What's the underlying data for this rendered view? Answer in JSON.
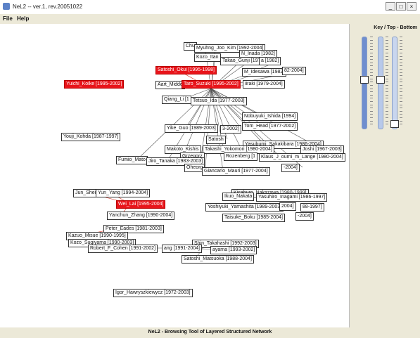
{
  "window": {
    "title": "NeL2 -- ver.1, rev.20051022",
    "min": "_",
    "max": "□",
    "close": "×"
  },
  "menu": {
    "items": [
      "File",
      "Help"
    ]
  },
  "panel": {
    "header": "Key / Top - Bottom",
    "sliders": [
      {
        "name": "slider-1",
        "color": "#6f8ecf",
        "level": 0.46
      },
      {
        "name": "slider-2",
        "color": "#b8c9ea",
        "level": 0.46
      },
      {
        "name": "slider-3",
        "color": "#c9d6ee",
        "level": 0.98
      }
    ]
  },
  "status": "NeL2 - Browsing Tool of Layered Structured Network",
  "graph": {
    "nodes": [
      {
        "label": "Chu",
        "selected": false
      },
      {
        "label": "Myuhng_Joo_Kim [1992-2004]",
        "selected": false
      },
      {
        "label": "N_Inada [1982]",
        "selected": false
      },
      {
        "label": "Kozo_Itan",
        "selected": false
      },
      {
        "label": "Takao_Gunji [1977]",
        "selected": false
      },
      {
        "label": "a [1982]",
        "selected": false
      },
      {
        "label": "Satoshi_Okui [1995-1998]",
        "selected": true
      },
      {
        "label": "M_Idesawa [1982]",
        "selected": false
      },
      {
        "label": "82-2004]",
        "selected": false
      },
      {
        "label": "Yuichi_Koike [1995-2002]",
        "selected": true
      },
      {
        "label": "Aart_Midde",
        "selected": false
      },
      {
        "label": "Taro_Suzuki [1995-2002]",
        "selected": true
      },
      {
        "label": "iiraki [1979-2004]",
        "selected": false
      },
      {
        "label": "Qiang_Li [1",
        "selected": false
      },
      {
        "label": "Tetsuo_Ida [1977-2003]",
        "selected": false
      },
      {
        "label": "Nobuyuki_Ishida [1994]",
        "selected": false
      },
      {
        "label": "Yike_Guo [1989-2003]",
        "selected": false
      },
      {
        "label": "3-2002]",
        "selected": false
      },
      {
        "label": "Tom_Head [1977-2002]",
        "selected": false
      },
      {
        "label": "Youji_Kohda [1987-1997]",
        "selected": false
      },
      {
        "label": "Satosh",
        "selected": false
      },
      {
        "label": "Yasubumi_Sakakibara [1986-2004]",
        "selected": false
      },
      {
        "label": "Makoto_Kishis",
        "selected": false
      },
      {
        "label": "Takashi_Yokomori [1980-2004]",
        "selected": false
      },
      {
        "label": "Joshi [1967-2003]",
        "selected": false
      },
      {
        "label": "Grzegorz",
        "selected": false
      },
      {
        "label": "Rozenberg [1",
        "selected": false
      },
      {
        "label": "Klaus_J_ourni_m_Lange [1980-2004]",
        "selected": false
      },
      {
        "label": "Fumio_Mato",
        "selected": false
      },
      {
        "label": "Jiro_Tanaka [1983-2003]",
        "selected": false
      },
      {
        "label": "Oheorg",
        "selected": false
      },
      {
        "label": "Giancarlo_Mauri [1977-2004]",
        "selected": false
      },
      {
        "label": "-2004]",
        "selected": false
      },
      {
        "label": "Jun_Shei",
        "selected": false
      },
      {
        "label": "Yun_Yang [1994-2004]",
        "selected": false
      },
      {
        "label": "Kisaburo_Nakazawa [1980-1999]",
        "selected": false
      },
      {
        "label": "Ikuo_Nakata",
        "selected": false
      },
      {
        "label": "Yasuhiro_Inagami [1986-1997]",
        "selected": false
      },
      {
        "label": "Wei_Lai [1995-2004]",
        "selected": true
      },
      {
        "label": "Yoshiyuki_Yamashita [1989-2003]",
        "selected": false
      },
      {
        "label": "2004]",
        "selected": false
      },
      {
        "label": "88-1997]",
        "selected": false
      },
      {
        "label": "Yanchun_Zhang [1990-2004]",
        "selected": false
      },
      {
        "label": "Taisuke_Boku [1985-2004]",
        "selected": false
      },
      {
        "label": "-2004]",
        "selected": false
      },
      {
        "label": "Peter_Eades [1981-2003]",
        "selected": false
      },
      {
        "label": "Kazuo_Misue [1990-1995]",
        "selected": false
      },
      {
        "label": "Kozo_Sugiyama [1990-2003]",
        "selected": false
      },
      {
        "label": "Shin_Takahashi [1992-2003]",
        "selected": false
      },
      {
        "label": "Robert_F_Cohen [1991-2002]",
        "selected": false
      },
      {
        "label": "ang [1991-2004]",
        "selected": false
      },
      {
        "label": "ayama [1993-2002]",
        "selected": false
      },
      {
        "label": "Satoshi_Matsuoka [1988-2004]",
        "selected": false
      },
      {
        "label": "Igor_Hawryszkiewycz [1972-2003]",
        "selected": false
      }
    ]
  }
}
